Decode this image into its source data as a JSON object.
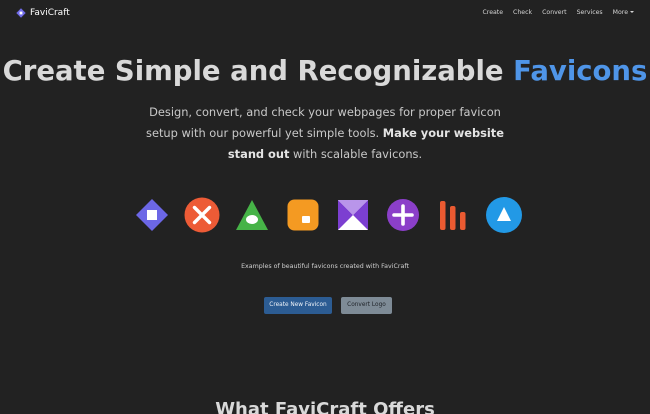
{
  "navbar": {
    "brand_name": "FaviCraft",
    "brand_icon": "favicraft-diamond-logo",
    "links": [
      "Create",
      "Check",
      "Convert",
      "Services",
      "More"
    ]
  },
  "hero": {
    "title_main": "Create Simple and Recognizable ",
    "title_accent": "Favicons",
    "subtitle_part1": "Design, convert, and check your webpages for proper favicon setup with our powerful yet simple tools. ",
    "subtitle_bold": "Make your website stand out",
    "subtitle_part2": " with scalable favicons."
  },
  "examples": {
    "icons": [
      "purple-diamond-icon",
      "orange-x-circle-icon",
      "green-triangle-icon",
      "orange-square-icon",
      "purple-bowtie-icon",
      "purple-plus-circle-icon",
      "orange-bars-icon",
      "blue-triangle-circle-icon"
    ],
    "caption": "Examples of beautiful favicons created with FaviCraft"
  },
  "actions": {
    "primary_label": "Create New Favicon",
    "secondary_label": "Convert Logo"
  },
  "offers": {
    "title": "What FaviCraft Offers"
  },
  "colors": {
    "background": "#222222",
    "accent": "#4f95e8",
    "primary_button": "#2c5c93",
    "secondary_button": "#7e8b96"
  }
}
